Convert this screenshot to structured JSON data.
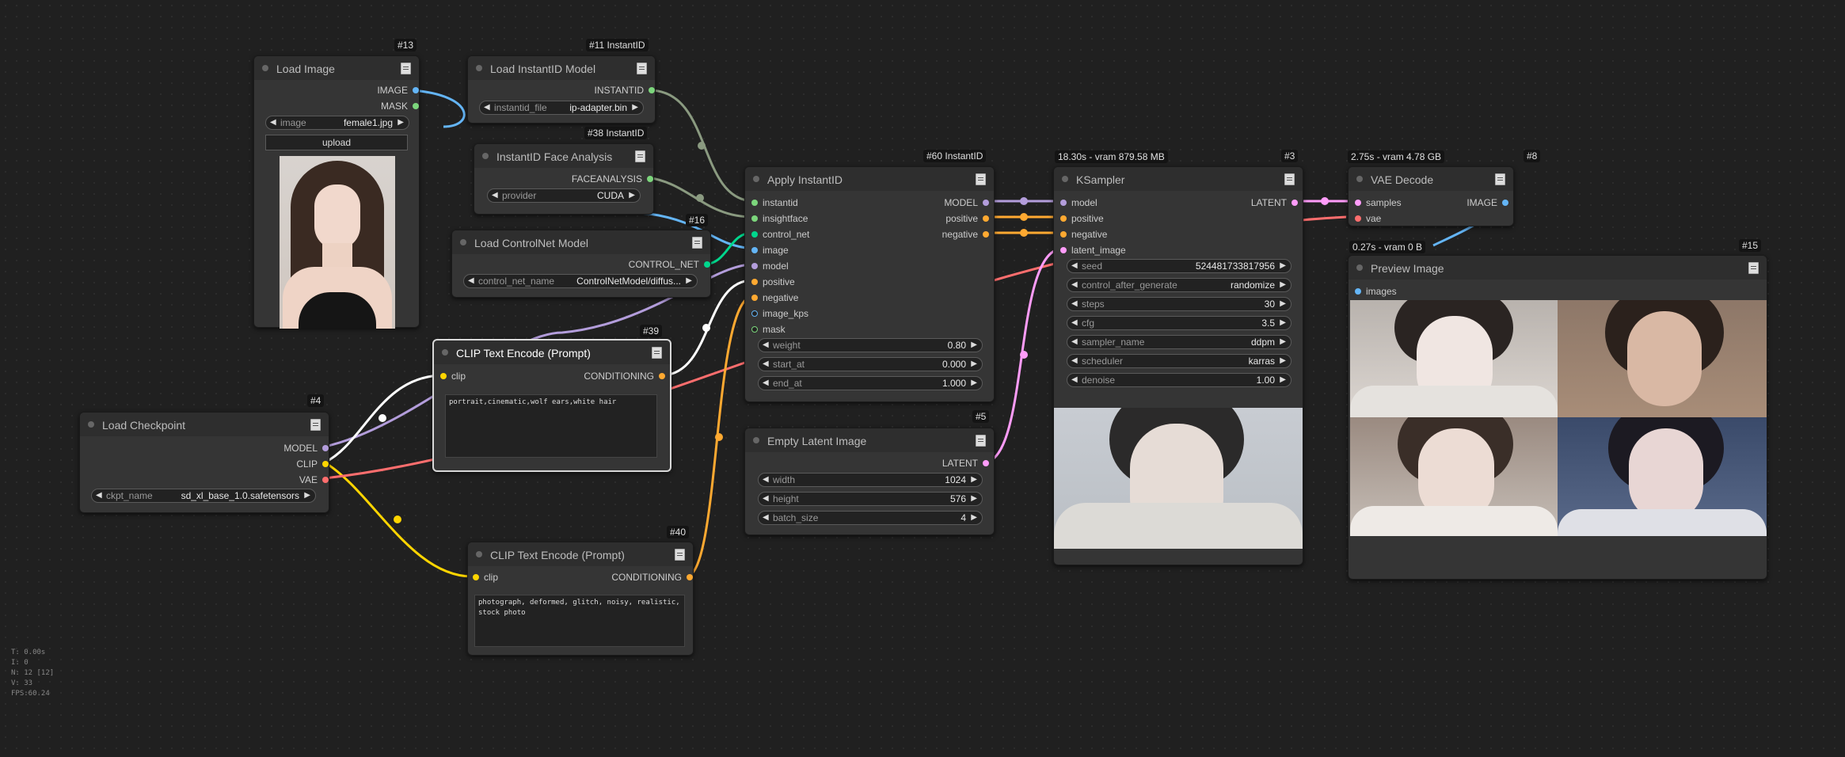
{
  "stats": {
    "t": "T: 0.00s",
    "i": "I: 0",
    "n": "N: 12 [12]",
    "v": "V: 33",
    "fps": "FPS:60.24"
  },
  "colors": {
    "image": "#64b5f6",
    "model": "#b39ddb",
    "clip": "#ffd500",
    "vae": "#ff6e6e",
    "conditioning": "#ffa931",
    "latent": "#ff9cf9",
    "controlnet": "#00d78d",
    "instantid": "#7cd67c",
    "faceanalysis": "#7cd67c"
  },
  "nodes": {
    "load_image": {
      "badge": "#13",
      "title": "Load Image",
      "out_image": "IMAGE",
      "out_mask": "MASK",
      "w_image_name": "image",
      "w_image_value": "female1.jpg",
      "upload": "upload"
    },
    "load_instantid": {
      "badge": "#11 InstantID",
      "title": "Load InstantID Model",
      "out": "INSTANTID",
      "w_name": "instantid_file",
      "w_value": "ip-adapter.bin"
    },
    "face_analysis": {
      "badge": "#38 InstantID",
      "title": "InstantID Face Analysis",
      "out": "FACEANALYSIS",
      "w_name": "provider",
      "w_value": "CUDA"
    },
    "load_controlnet": {
      "badge": "#16",
      "title": "Load ControlNet Model",
      "out": "CONTROL_NET",
      "w_name": "control_net_name",
      "w_value": "ControlNetModel/diffus..."
    },
    "clip39": {
      "badge": "#39",
      "title": "CLIP Text Encode (Prompt)",
      "in": "clip",
      "out": "CONDITIONING",
      "text": "portrait,cinematic,wolf ears,white hair"
    },
    "checkpoint": {
      "badge": "#4",
      "title": "Load Checkpoint",
      "out_model": "MODEL",
      "out_clip": "CLIP",
      "out_vae": "VAE",
      "w_name": "ckpt_name",
      "w_value": "sd_xl_base_1.0.safetensors"
    },
    "clip40": {
      "badge": "#40",
      "title": "CLIP Text Encode (Prompt)",
      "in": "clip",
      "out": "CONDITIONING",
      "text": "photograph, deformed, glitch, noisy, realistic, stock photo"
    },
    "apply": {
      "badge": "#60 InstantID",
      "title": "Apply InstantID",
      "inputs": [
        "instantid",
        "insightface",
        "control_net",
        "image",
        "model",
        "positive",
        "negative",
        "image_kps",
        "mask"
      ],
      "outputs": [
        "MODEL",
        "positive",
        "negative"
      ],
      "widgets": [
        {
          "name": "weight",
          "value": "0.80"
        },
        {
          "name": "start_at",
          "value": "0.000"
        },
        {
          "name": "end_at",
          "value": "1.000"
        }
      ]
    },
    "empty_latent": {
      "badge": "#5",
      "title": "Empty Latent Image",
      "out": "LATENT",
      "widgets": [
        {
          "name": "width",
          "value": "1024"
        },
        {
          "name": "height",
          "value": "576"
        },
        {
          "name": "batch_size",
          "value": "4"
        }
      ]
    },
    "ksampler": {
      "badge": "#3",
      "timing": "18.30s - vram 879.58 MB",
      "title": "KSampler",
      "inputs": [
        "model",
        "positive",
        "negative",
        "latent_image"
      ],
      "out": "LATENT",
      "widgets": [
        {
          "name": "seed",
          "value": "524481733817956"
        },
        {
          "name": "control_after_generate",
          "value": "randomize"
        },
        {
          "name": "steps",
          "value": "30"
        },
        {
          "name": "cfg",
          "value": "3.5"
        },
        {
          "name": "sampler_name",
          "value": "ddpm"
        },
        {
          "name": "scheduler",
          "value": "karras"
        },
        {
          "name": "denoise",
          "value": "1.00"
        }
      ]
    },
    "vae_decode": {
      "badge": "#8",
      "timing": "2.75s - vram 4.78 GB",
      "title": "VAE Decode",
      "in_samples": "samples",
      "in_vae": "vae",
      "out": "IMAGE"
    },
    "preview": {
      "badge": "#15",
      "timing": "0.27s - vram 0 B",
      "title": "Preview Image",
      "in": "images"
    }
  }
}
